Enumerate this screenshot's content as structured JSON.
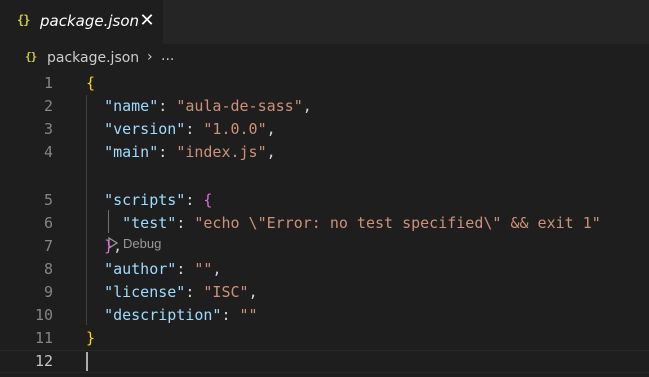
{
  "tab": {
    "icon": "{}",
    "label": "package.json",
    "close": "✕"
  },
  "breadcrumb": {
    "icon": "{}",
    "file": "package.json",
    "separator": "›",
    "more": "..."
  },
  "codelens": {
    "label": "Debug"
  },
  "lines": [
    {
      "num": "1",
      "tokens": [
        {
          "t": "{",
          "c": "b1"
        }
      ]
    },
    {
      "num": "2",
      "tokens": [
        {
          "t": "  "
        },
        {
          "t": "\"name\"",
          "c": "key"
        },
        {
          "t": ": "
        },
        {
          "t": "\"aula-de-sass\"",
          "c": "str"
        },
        {
          "t": ","
        }
      ]
    },
    {
      "num": "3",
      "tokens": [
        {
          "t": "  "
        },
        {
          "t": "\"version\"",
          "c": "key"
        },
        {
          "t": ": "
        },
        {
          "t": "\"1.0.0\"",
          "c": "str"
        },
        {
          "t": ","
        }
      ]
    },
    {
      "num": "4",
      "tokens": [
        {
          "t": "  "
        },
        {
          "t": "\"main\"",
          "c": "key"
        },
        {
          "t": ": "
        },
        {
          "t": "\"index.js\"",
          "c": "str"
        },
        {
          "t": ","
        }
      ]
    },
    {
      "num": "5",
      "tokens": [
        {
          "t": "  "
        },
        {
          "t": "\"scripts\"",
          "c": "key"
        },
        {
          "t": ": "
        },
        {
          "t": "{",
          "c": "b2"
        }
      ]
    },
    {
      "num": "6",
      "tokens": [
        {
          "t": "    "
        },
        {
          "t": "\"test\"",
          "c": "key"
        },
        {
          "t": ": "
        },
        {
          "t": "\"echo \\\"Error: no test specified\\\" && exit 1\"",
          "c": "str"
        }
      ]
    },
    {
      "num": "7",
      "tokens": [
        {
          "t": "  "
        },
        {
          "t": "}",
          "c": "b2"
        },
        {
          "t": ","
        }
      ]
    },
    {
      "num": "8",
      "tokens": [
        {
          "t": "  "
        },
        {
          "t": "\"author\"",
          "c": "key"
        },
        {
          "t": ": "
        },
        {
          "t": "\"\"",
          "c": "str"
        },
        {
          "t": ","
        }
      ]
    },
    {
      "num": "9",
      "tokens": [
        {
          "t": "  "
        },
        {
          "t": "\"license\"",
          "c": "key"
        },
        {
          "t": ": "
        },
        {
          "t": "\"ISC\"",
          "c": "str"
        },
        {
          "t": ","
        }
      ]
    },
    {
      "num": "10",
      "tokens": [
        {
          "t": "  "
        },
        {
          "t": "\"description\"",
          "c": "key"
        },
        {
          "t": ": "
        },
        {
          "t": "\"\"",
          "c": "str"
        }
      ]
    },
    {
      "num": "11",
      "tokens": [
        {
          "t": "}",
          "c": "b1"
        }
      ]
    },
    {
      "num": "12",
      "tokens": []
    }
  ],
  "active_line": "12",
  "colors": {
    "key": "#9cdcfe",
    "string": "#ce9178",
    "bracket1": "#ffd700",
    "bracket2": "#da70d6",
    "background": "#1e1e1e"
  }
}
